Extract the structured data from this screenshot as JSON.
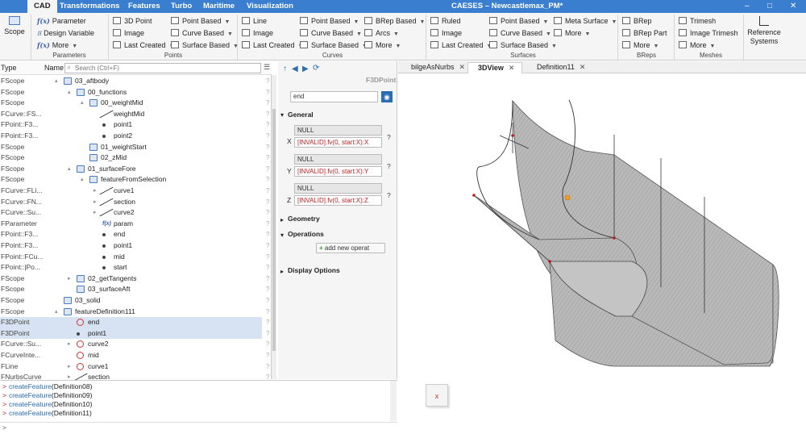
{
  "titlebar": {
    "menu_tabs": [
      "CAD",
      "Transformations",
      "Features",
      "Turbo",
      "Maritime",
      "Visualization"
    ],
    "window_title": "CAESES – Newcastlemax_PM*",
    "controls": [
      "–",
      "□",
      "✕"
    ]
  },
  "ribbon": {
    "scope_label": "Scope",
    "parameters": {
      "items": [
        "Parameter",
        "Design Variable",
        "More"
      ],
      "group": "Parameters"
    },
    "points": {
      "col1": [
        "3D Point",
        "Image",
        "Last Created"
      ],
      "col2": [
        "Point Based",
        "Curve Based",
        "Surface Based"
      ],
      "group": "Points"
    },
    "curves": {
      "col1": [
        "Line",
        "Image",
        "Last Created"
      ],
      "col2": [
        "Point Based",
        "Curve Based",
        "Surface Based"
      ],
      "col3": [
        "BRep Based",
        "Arcs",
        "More"
      ],
      "group": "Curves"
    },
    "surfaces": {
      "col1": [
        "Ruled",
        "Image",
        "Last Created"
      ],
      "col2": [
        "Point Based",
        "Curve Based",
        "Surface Based"
      ],
      "col3": [
        "Meta Surface",
        "More"
      ],
      "group": "Surfaces"
    },
    "breps": {
      "items": [
        "BRep",
        "BRep Part",
        "More"
      ],
      "group": "BReps"
    },
    "meshes": {
      "items": [
        "Trimesh",
        "Image Trimesh",
        "More"
      ],
      "group": "Meshes"
    },
    "reference_label": "Reference Systems"
  },
  "tree": {
    "header": {
      "type": "Type",
      "name": "Name",
      "search_placeholder": "Search (Ctrl+F)"
    },
    "rows": [
      {
        "type": "FScope",
        "name": "03_aftbody",
        "indent": 0,
        "icon": "folder",
        "tog": "▴"
      },
      {
        "type": "FScope",
        "name": "00_functions",
        "indent": 1,
        "icon": "folder",
        "tog": "▴"
      },
      {
        "type": "FScope",
        "name": "00_weightMid",
        "indent": 2,
        "icon": "folder",
        "tog": "▴"
      },
      {
        "type": "FCurve::FS...",
        "name": "weightMid",
        "indent": 3,
        "icon": "curve",
        "tog": ""
      },
      {
        "type": "FPoint::F3...",
        "name": "point1",
        "indent": 3,
        "icon": "dot",
        "tog": ""
      },
      {
        "type": "FPoint::F3...",
        "name": "point2",
        "indent": 3,
        "icon": "dot",
        "tog": ""
      },
      {
        "type": "FScope",
        "name": "01_weightStart",
        "indent": 2,
        "icon": "folder",
        "tog": ""
      },
      {
        "type": "FScope",
        "name": "02_zMid",
        "indent": 2,
        "icon": "folder",
        "tog": ""
      },
      {
        "type": "FScope",
        "name": "01_surfaceFore",
        "indent": 1,
        "icon": "folder",
        "tog": "▴"
      },
      {
        "type": "FScope",
        "name": "featureFromSelection",
        "indent": 2,
        "icon": "folder",
        "tog": "▴"
      },
      {
        "type": "FCurve::FLi...",
        "name": "curve1",
        "indent": 3,
        "icon": "curve",
        "tog": "▸"
      },
      {
        "type": "FCurve::FN...",
        "name": "section",
        "indent": 3,
        "icon": "curve",
        "tog": "▸"
      },
      {
        "type": "FCurve::Su...",
        "name": "curve2",
        "indent": 3,
        "icon": "curve",
        "tog": "▸"
      },
      {
        "type": "FParameter",
        "name": "param",
        "indent": 3,
        "icon": "fx",
        "tog": ""
      },
      {
        "type": "FPoint::F3...",
        "name": "end",
        "indent": 3,
        "icon": "dot",
        "tog": ""
      },
      {
        "type": "FPoint::F3...",
        "name": "point1",
        "indent": 3,
        "icon": "dot",
        "tog": ""
      },
      {
        "type": "FPoint::FCu...",
        "name": "mid",
        "indent": 3,
        "icon": "dot",
        "tog": ""
      },
      {
        "type": "FPoint::|Po...",
        "name": "start",
        "indent": 3,
        "icon": "dot",
        "tog": ""
      },
      {
        "type": "FScope",
        "name": "02_getTangents",
        "indent": 1,
        "icon": "folder",
        "tog": "▸"
      },
      {
        "type": "FScope",
        "name": "03_surfaceAft",
        "indent": 1,
        "icon": "folder",
        "tog": ""
      },
      {
        "type": "FScope",
        "name": "03_solid",
        "indent": 0,
        "icon": "folder",
        "tog": ""
      },
      {
        "type": "FScope",
        "name": "featureDefinition111",
        "indent": 0,
        "icon": "folder",
        "tog": "▴"
      },
      {
        "type": "F3DPoint",
        "name": "end",
        "indent": 1,
        "icon": "err",
        "tog": "",
        "sel": true
      },
      {
        "type": "F3DPoint",
        "name": "point1",
        "indent": 1,
        "icon": "dot",
        "tog": "",
        "sel": true
      },
      {
        "type": "FCurve::Su...",
        "name": "curve2",
        "indent": 1,
        "icon": "err",
        "tog": "▸"
      },
      {
        "type": "FCurveInte...",
        "name": "mid",
        "indent": 1,
        "icon": "err",
        "tog": ""
      },
      {
        "type": "FLine",
        "name": "curve1",
        "indent": 1,
        "icon": "err",
        "tog": "▸"
      },
      {
        "type": "FNurbsCurve",
        "name": "section",
        "indent": 1,
        "icon": "curve",
        "tog": "▸"
      }
    ]
  },
  "props": {
    "toolbar": {
      "up": "↑",
      "back": "◀",
      "forward": "▶",
      "sync": "⟳"
    },
    "object_type": "F3DPoint",
    "name_value": "end",
    "sections": {
      "general": "General",
      "geometry": "Geometry",
      "operations": "Operations",
      "display": "Display Options"
    },
    "coords": [
      {
        "axis": "X",
        "null": "NULL",
        "expr": "[INVALID].fv(0, start:X):X"
      },
      {
        "axis": "Y",
        "null": "NULL",
        "expr": "[INVALID].fv(0, start:X):Y"
      },
      {
        "axis": "Z",
        "null": "NULL",
        "expr": "[INVALID].fv(0, start:X):Z"
      }
    ],
    "add_operation": "add new operat"
  },
  "view_tabs": {
    "tabs": [
      "bilgeAsNurbs",
      "3DView",
      "Definition11"
    ],
    "active": "3DView"
  },
  "console": {
    "lines": [
      "createFeature(Definition08)",
      "createFeature(Definition09)",
      "createFeature(Definition10)",
      "createFeature(Definition11)"
    ],
    "fn": "createFeature",
    "prompt": ">"
  },
  "colors": {
    "accent": "#3a7ecf",
    "error": "#c02020",
    "selection": "#d7e3f2"
  }
}
